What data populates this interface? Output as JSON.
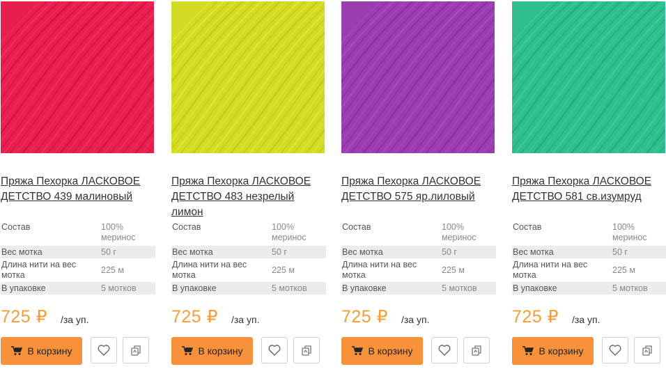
{
  "cart_label": "В корзину",
  "per_unit": "/за уп.",
  "products": [
    {
      "title": "Пряжа Пехорка ЛАСКОВОЕ ДЕТСТВО 439 малиновый",
      "color": "#e8204e",
      "specs": [
        {
          "k": "Состав",
          "v": "100% меринос"
        },
        {
          "k": "Вес мотка",
          "v": "50 г"
        },
        {
          "k": "Длина нити на вес мотка",
          "v": "225 м"
        },
        {
          "k": "В упаковке",
          "v": "5 мотков"
        }
      ],
      "price": "725 ₽"
    },
    {
      "title": "Пряжа Пехорка ЛАСКОВОЕ ДЕТСТВО 483 незрелый лимон",
      "color": "#d2dc24",
      "specs": [
        {
          "k": "Состав",
          "v": "100% меринос"
        },
        {
          "k": "Вес мотка",
          "v": "50 г"
        },
        {
          "k": "Длина нити на вес мотка",
          "v": "225 м"
        },
        {
          "k": "В упаковке",
          "v": "5 мотков"
        }
      ],
      "price": "725 ₽"
    },
    {
      "title": "Пряжа Пехорка ЛАСКОВОЕ ДЕТСТВО 575 яр.лиловый",
      "color": "#9b3eb0",
      "specs": [
        {
          "k": "Состав",
          "v": "100% меринос"
        },
        {
          "k": "Вес мотка",
          "v": "50 г"
        },
        {
          "k": "Длина нити на вес мотка",
          "v": "225 м"
        },
        {
          "k": "В упаковке",
          "v": "5 мотков"
        }
      ],
      "price": "725 ₽"
    },
    {
      "title": "Пряжа Пехорка ЛАСКОВОЕ ДЕТСТВО 581 св.изумруд",
      "color": "#2ebf8c",
      "specs": [
        {
          "k": "Состав",
          "v": "100% меринос"
        },
        {
          "k": "Вес мотка",
          "v": "50 г"
        },
        {
          "k": "Длина нити на вес мотка",
          "v": "225 м"
        },
        {
          "k": "В упаковке",
          "v": "5 мотков"
        }
      ],
      "price": "725 ₽"
    }
  ]
}
